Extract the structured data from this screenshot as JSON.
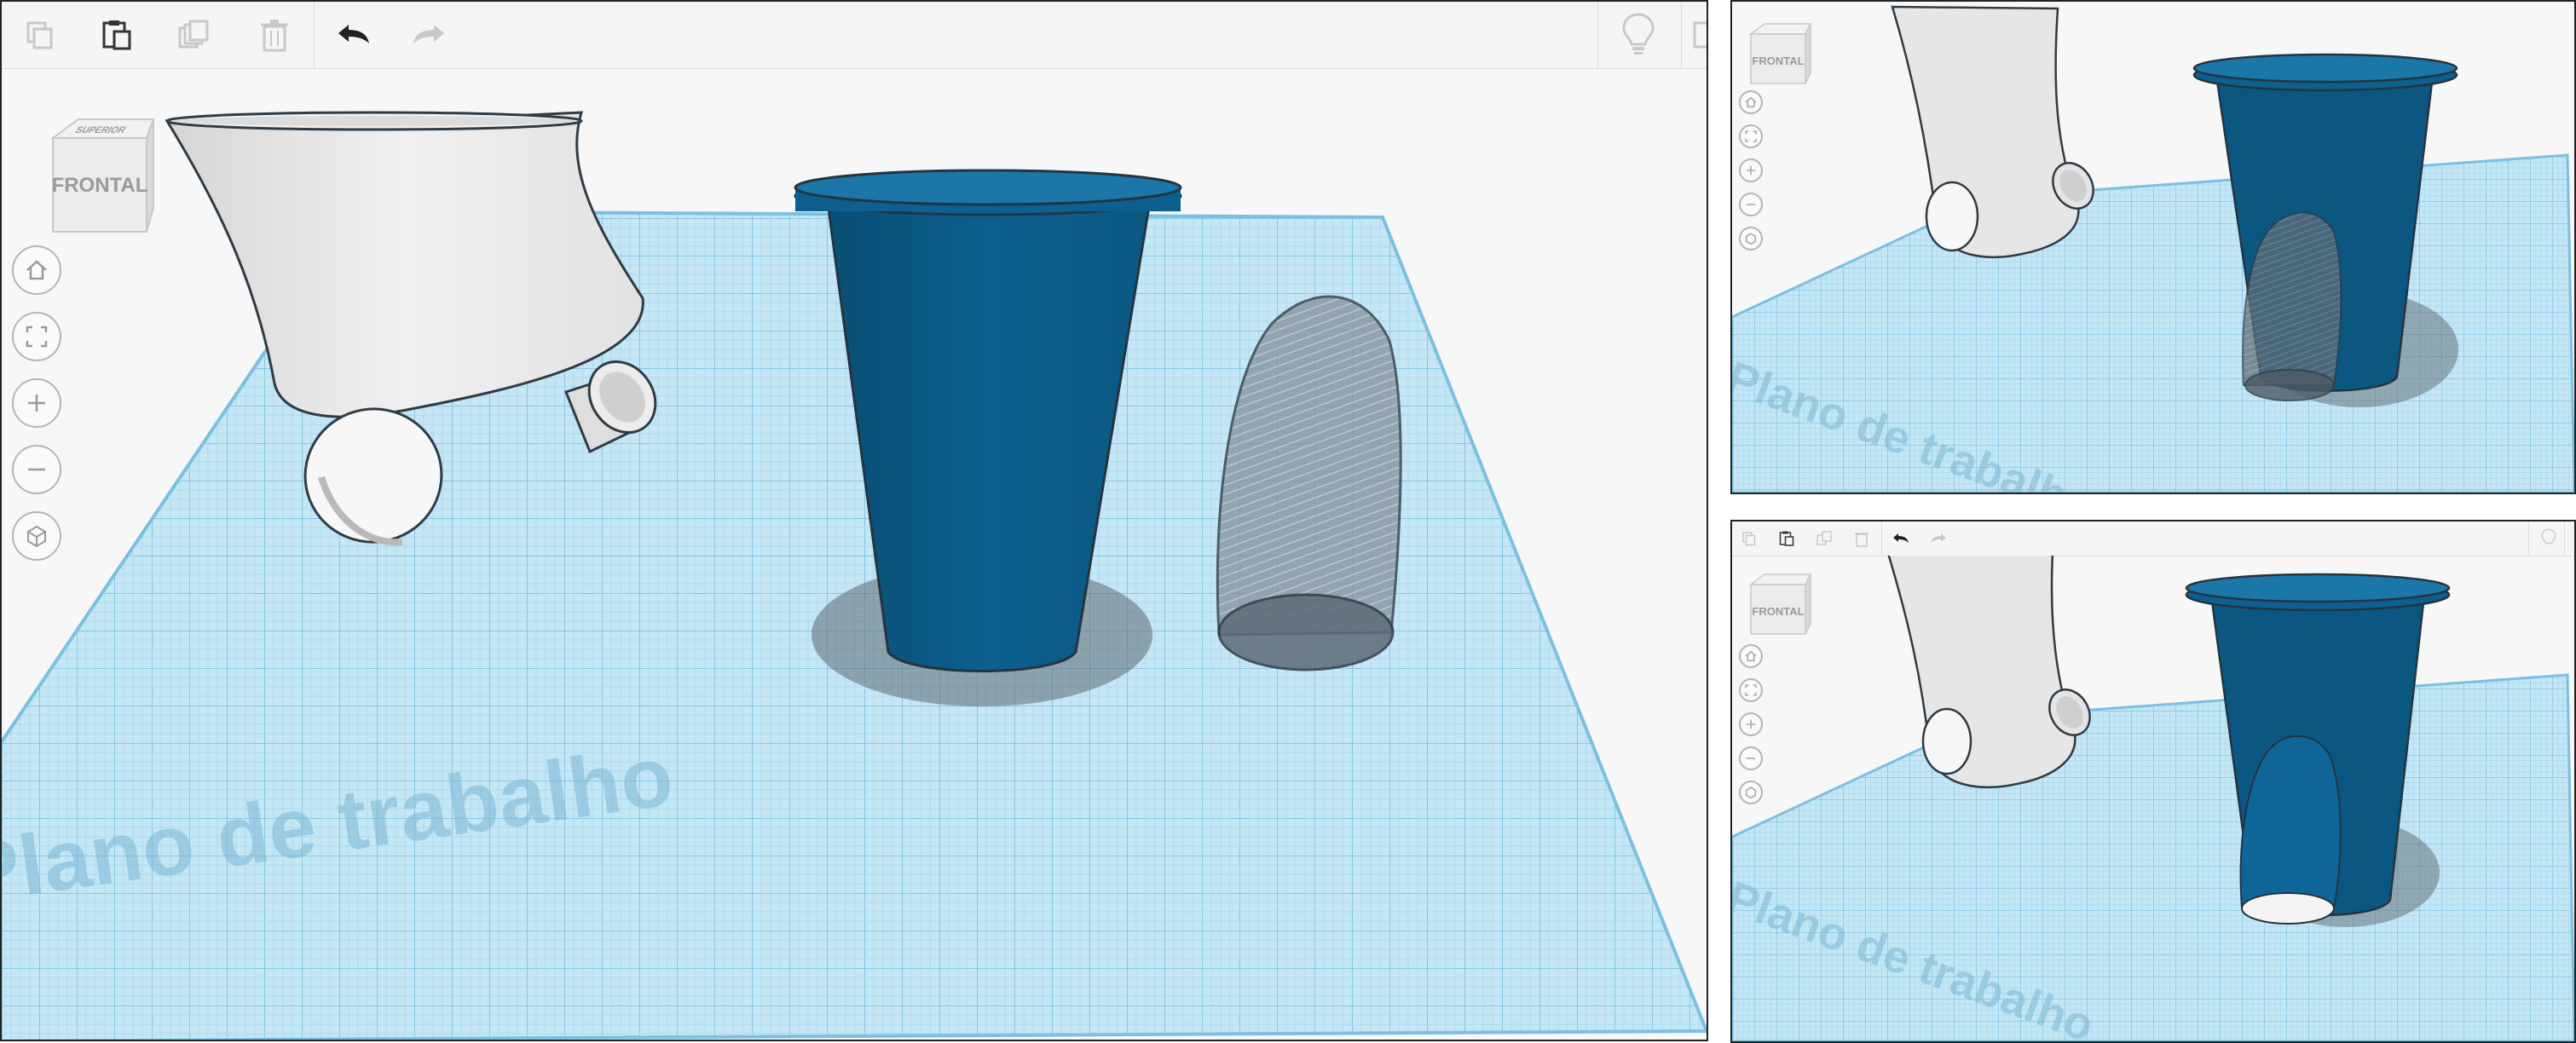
{
  "navcube": {
    "front_label": "FRONTAL",
    "top_label": "SUPERIOR"
  },
  "workplane": {
    "label": "Plano de trabalho"
  },
  "toolbar": {
    "buttons": [
      {
        "id": "copy",
        "icon": "copy-icon",
        "enabled": false
      },
      {
        "id": "paste",
        "icon": "paste-icon",
        "enabled": true
      },
      {
        "id": "duplicate",
        "icon": "duplicate-icon",
        "enabled": false
      },
      {
        "id": "delete",
        "icon": "trash-icon",
        "enabled": false
      },
      {
        "id": "undo",
        "icon": "undo-icon",
        "enabled": true
      },
      {
        "id": "redo",
        "icon": "redo-icon",
        "enabled": false
      },
      {
        "id": "hint",
        "icon": "lightbulb-icon",
        "enabled": false
      }
    ]
  },
  "view_controls": [
    "home-icon",
    "fit-all-icon",
    "zoom-in-icon",
    "zoom-out-icon",
    "perspective-icon"
  ],
  "colors": {
    "shape_gray": "#e4e4e4",
    "shape_blue": "#0b5a86",
    "hole_translucent": "#6f7f8c",
    "workplane": "#bfe3f3",
    "grid_line": "#7cc3e3"
  }
}
